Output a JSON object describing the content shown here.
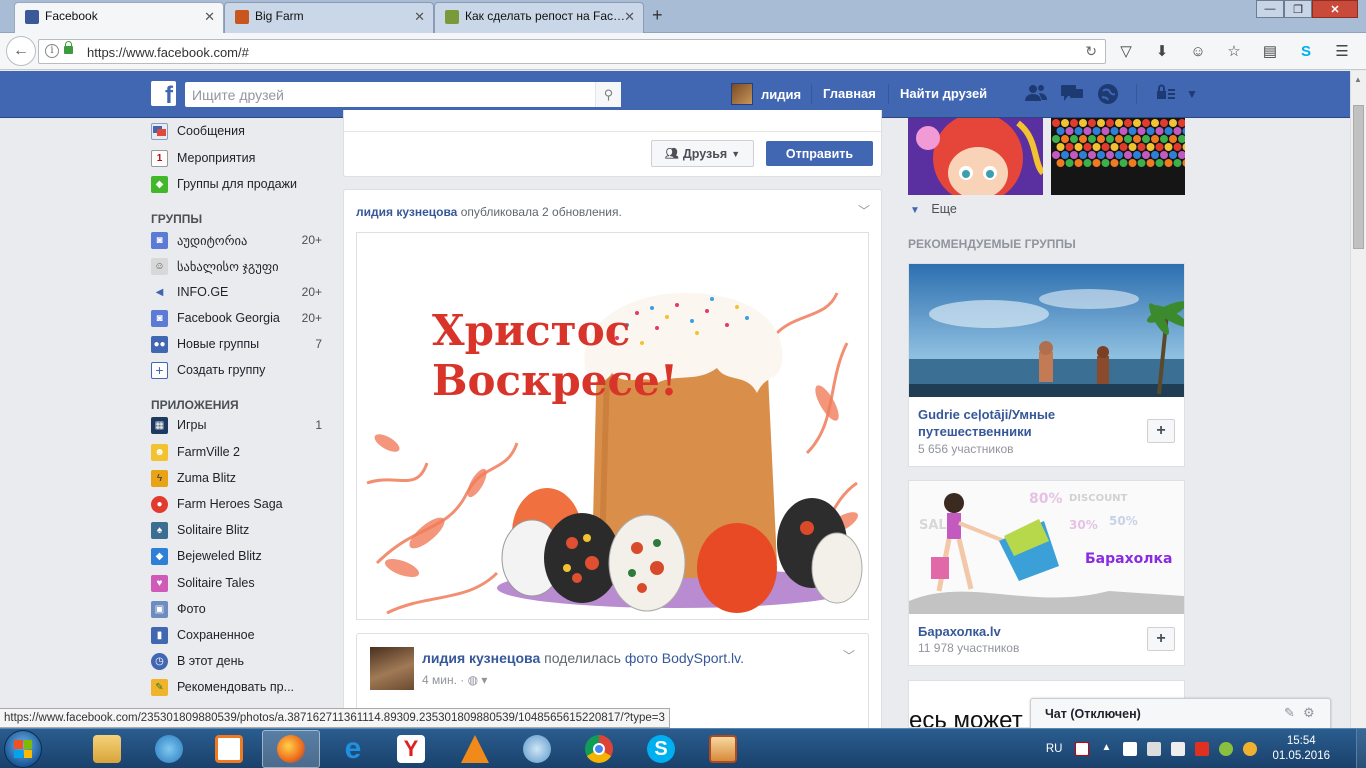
{
  "browser": {
    "tabs": [
      {
        "label": "Facebook"
      },
      {
        "label": "Big Farm"
      },
      {
        "label": "Как сделать репост на Fac…"
      }
    ],
    "url": "https://www.facebook.com/#",
    "status_url": "https://www.facebook.com/235301809880539/photos/a.387162711361114.89309.235301809880539/1048565615220817/?type=3"
  },
  "fb_header": {
    "search_placeholder": "Ищите друзей",
    "profile_name": "лидия",
    "nav_home": "Главная",
    "nav_find_friends": "Найти друзей"
  },
  "sidebar": {
    "top_items": [
      {
        "label": "Сообщения"
      },
      {
        "label": "Мероприятия"
      },
      {
        "label": "Группы для продажи"
      }
    ],
    "groups_heading": "ГРУППЫ",
    "groups": [
      {
        "label": "აუდიტორია",
        "count": "20+"
      },
      {
        "label": "სახალისო ჯგუფი",
        "count": ""
      },
      {
        "label": "INFO.GE",
        "count": "20+"
      },
      {
        "label": "Facebook Georgia",
        "count": "20+"
      },
      {
        "label": "Новые группы",
        "count": "7"
      },
      {
        "label": "Создать группу",
        "count": ""
      }
    ],
    "apps_heading": "ПРИЛОЖЕНИЯ",
    "apps": [
      {
        "label": "Игры",
        "count": "1"
      },
      {
        "label": "FarmVille 2",
        "count": ""
      },
      {
        "label": "Zuma Blitz",
        "count": ""
      },
      {
        "label": "Farm Heroes Saga",
        "count": ""
      },
      {
        "label": "Solitaire Blitz",
        "count": ""
      },
      {
        "label": "Bejeweled Blitz",
        "count": ""
      },
      {
        "label": "Solitaire Tales",
        "count": ""
      },
      {
        "label": "Фото",
        "count": ""
      },
      {
        "label": "Сохраненное",
        "count": ""
      },
      {
        "label": "В этот день",
        "count": ""
      },
      {
        "label": "Рекомендовать пр...",
        "count": ""
      }
    ]
  },
  "composer": {
    "audience_label": "Друзья",
    "send_label": "Отправить"
  },
  "post": {
    "author": "лидия кузнецова",
    "action": "опубликовала 2 обновления.",
    "image_text": [
      "Христос",
      "Воскресе!"
    ],
    "shared": {
      "author": "лидия кузнецова",
      "action": "поделилась",
      "link_text": "фото BodySport.lv.",
      "time": "4 мин."
    }
  },
  "right": {
    "more_label": "Еще",
    "recommended_heading": "РЕКОМЕНДУЕМЫЕ ГРУППЫ",
    "groups": [
      {
        "name": "Gudrie ceļotāji/Умные путешественники",
        "members": "5 656 участников"
      },
      {
        "name": "Барахолка.lv",
        "members": "11 978 участников",
        "image_text": "Барахолка"
      }
    ],
    "partial_text": "есь может"
  },
  "chat": {
    "label": "Чат (Отключен)"
  },
  "taskbar": {
    "lang": "RU",
    "time": "15:54",
    "date": "01.05.2016"
  }
}
